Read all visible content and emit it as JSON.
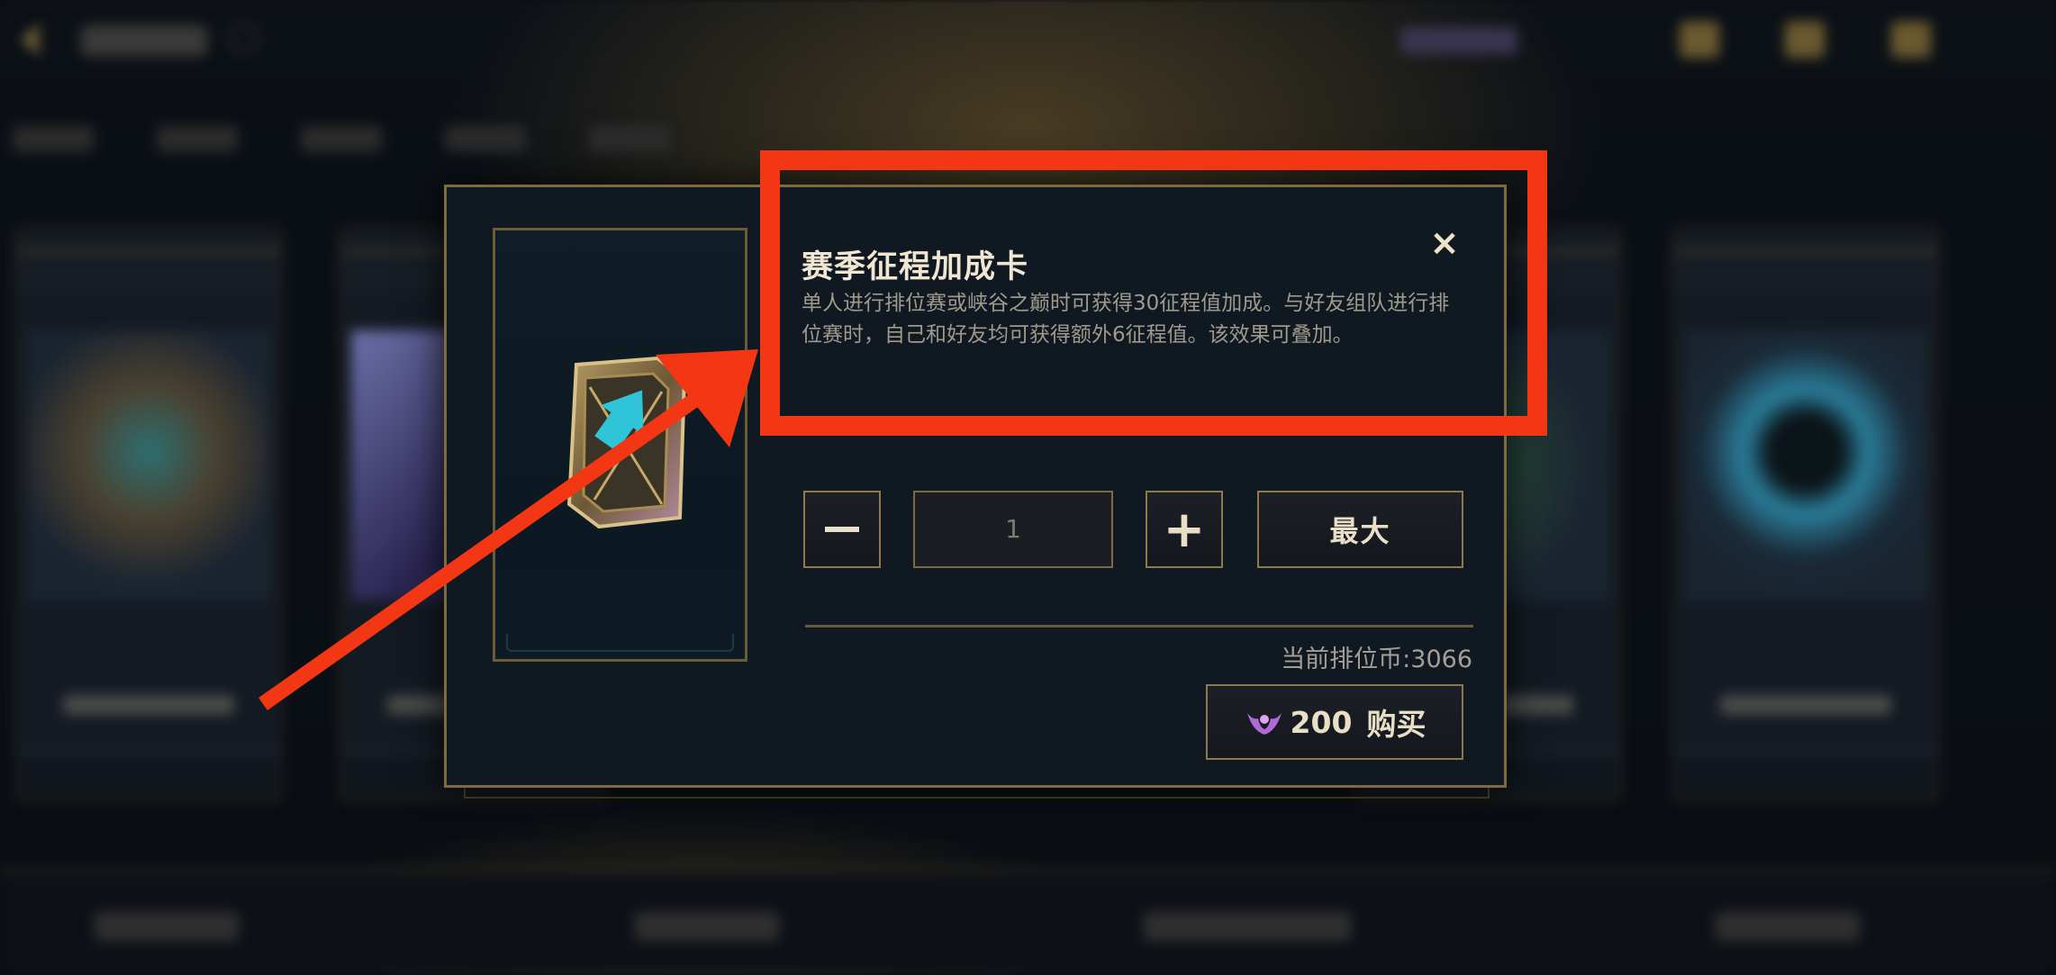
{
  "dialog": {
    "item_title": "赛季征程加成卡",
    "item_description": "单人进行排位赛或峡谷之巅时可获得30征程值加成。与好友组队进行排位赛时，自己和好友均可获得额外6征程值。该效果可叠加。",
    "close_icon": "×",
    "quantity_value": "1",
    "plus_label": "+",
    "max_label": "最大",
    "currency_label": "当前排位币:3066",
    "buy_price": "200",
    "buy_label": "购买"
  },
  "icons": {
    "back": "back-arrow-icon",
    "minus": "minus-icon",
    "plus": "plus-icon",
    "close": "close-icon",
    "currency": "ranked-coin-icon",
    "item": "boost-card-icon"
  },
  "colors": {
    "annotation_red": "#f33614",
    "gold_border": "#8c7a4b",
    "currency_purple": "#b06ad8"
  }
}
